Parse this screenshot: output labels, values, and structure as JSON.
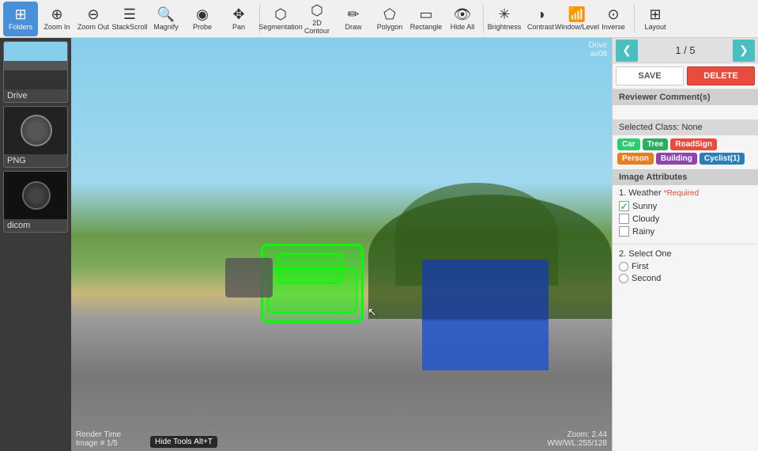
{
  "toolbar": {
    "tools": [
      {
        "id": "folders",
        "label": "Folders",
        "icon": "⊞",
        "active": true
      },
      {
        "id": "zoom-in",
        "label": "Zoom In",
        "icon": "⊕",
        "active": false
      },
      {
        "id": "zoom-out",
        "label": "Zoom Out",
        "icon": "⊖",
        "active": false
      },
      {
        "id": "stack-scroll",
        "label": "StackScroll",
        "icon": "☰",
        "active": false
      },
      {
        "id": "magnify",
        "label": "Magnify",
        "icon": "🔍",
        "active": false
      },
      {
        "id": "probe",
        "label": "Probe",
        "icon": "◎",
        "active": false
      },
      {
        "id": "pan",
        "label": "Pan",
        "icon": "✥",
        "active": false
      },
      {
        "id": "segmentation",
        "label": "Segmentation",
        "icon": "⬡",
        "active": false
      },
      {
        "id": "2d-contour",
        "label": "2D Contour",
        "icon": "⬡",
        "active": false
      },
      {
        "id": "draw",
        "label": "Draw",
        "icon": "✏",
        "active": false
      },
      {
        "id": "polygon",
        "label": "Polygon",
        "icon": "⬠",
        "active": false
      },
      {
        "id": "rectangle",
        "label": "Rectangle",
        "icon": "▭",
        "active": false
      },
      {
        "id": "hide-all",
        "label": "Hide All",
        "icon": "👁",
        "active": false
      },
      {
        "id": "brightness",
        "label": "Brightness",
        "icon": "✳",
        "active": false
      },
      {
        "id": "contrast",
        "label": "Contrast",
        "icon": "◑",
        "active": false
      },
      {
        "id": "window-level",
        "label": "Window/Level",
        "icon": "📊",
        "active": false
      },
      {
        "id": "inverse",
        "label": "Inverse",
        "icon": "⊙",
        "active": false
      },
      {
        "id": "layout",
        "label": "Layout",
        "icon": "⊞",
        "active": false
      }
    ]
  },
  "sidebar": {
    "items": [
      {
        "id": "drive",
        "label": "Drive",
        "type": "drive"
      },
      {
        "id": "png",
        "label": "PNG",
        "type": "png"
      },
      {
        "id": "dicom",
        "label": "dicom",
        "type": "dicom"
      }
    ]
  },
  "viewer": {
    "info_tl": "",
    "info_tr": "Drive\nav08",
    "info_bl": "Render Time\nImage # 1/5",
    "info_br": "Zoom: 2.44\nWW/WL:255/128",
    "hide_tools_label": "Hide Tools",
    "hide_tools_shortcut": "Alt+T"
  },
  "right_panel": {
    "nav": {
      "prev_label": "❮",
      "counter": "1 / 5",
      "next_label": "❯"
    },
    "save_label": "SAVE",
    "delete_label": "DELETE",
    "reviewer_comments_label": "Reviewer Comment(s)",
    "selected_class_label": "Selected Class: None",
    "class_tags": [
      {
        "id": "car",
        "label": "Car",
        "class": "tag-car"
      },
      {
        "id": "tree",
        "label": "Tree",
        "class": "tag-tree"
      },
      {
        "id": "roadsign",
        "label": "RoadSign",
        "class": "tag-roadsign"
      },
      {
        "id": "person",
        "label": "Person",
        "class": "tag-person"
      },
      {
        "id": "building",
        "label": "Building",
        "class": "tag-building"
      },
      {
        "id": "cyclist",
        "label": "Cyclist(1)",
        "class": "tag-cyclist"
      }
    ],
    "image_attributes_label": "Image Attributes",
    "attribute_1": {
      "number": "1.",
      "label": "Weather",
      "required_text": "*Required",
      "options": [
        {
          "id": "sunny",
          "label": "Sunny",
          "checked": true
        },
        {
          "id": "cloudy",
          "label": "Cloudy",
          "checked": false
        },
        {
          "id": "rainy",
          "label": "Rainy",
          "checked": false
        }
      ]
    },
    "attribute_2": {
      "number": "2.",
      "label": "Select One",
      "options": [
        {
          "id": "first",
          "label": "First"
        },
        {
          "id": "second",
          "label": "Second"
        }
      ]
    }
  }
}
